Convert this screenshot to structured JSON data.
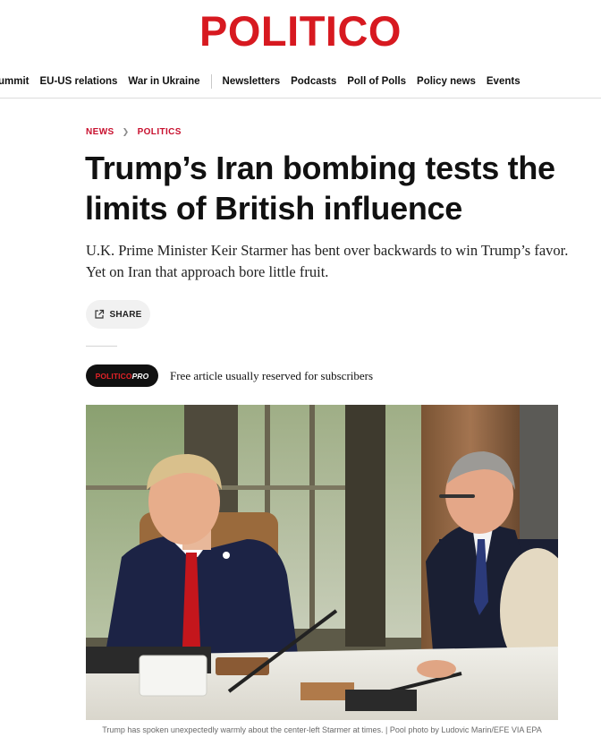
{
  "brand": {
    "logo_text": "POLITICO",
    "accent_color": "#d71920"
  },
  "nav": {
    "items": [
      "ummit",
      "EU-US relations",
      "War in Ukraine",
      "Newsletters",
      "Podcasts",
      "Poll of Polls",
      "Policy news",
      "Events"
    ]
  },
  "breadcrumb": {
    "section": "NEWS",
    "subsection": "POLITICS"
  },
  "article": {
    "headline": "Trump’s Iran bombing tests the limits of British influence",
    "dek": "U.K. Prime Minister Keir Starmer has bent over backwards to win Trump’s favor. Yet on Iran that approach bore little fruit.",
    "share_label": "SHARE",
    "pro_badge": {
      "part1": "POLITICO",
      "part2": "PRO"
    },
    "pro_note": "Free article usually reserved for subscribers",
    "image_caption": "Trump has spoken unexpectedly warmly about the center-left Starmer at times. | Pool photo by Ludovic Marin/EFE VIA EPA"
  }
}
